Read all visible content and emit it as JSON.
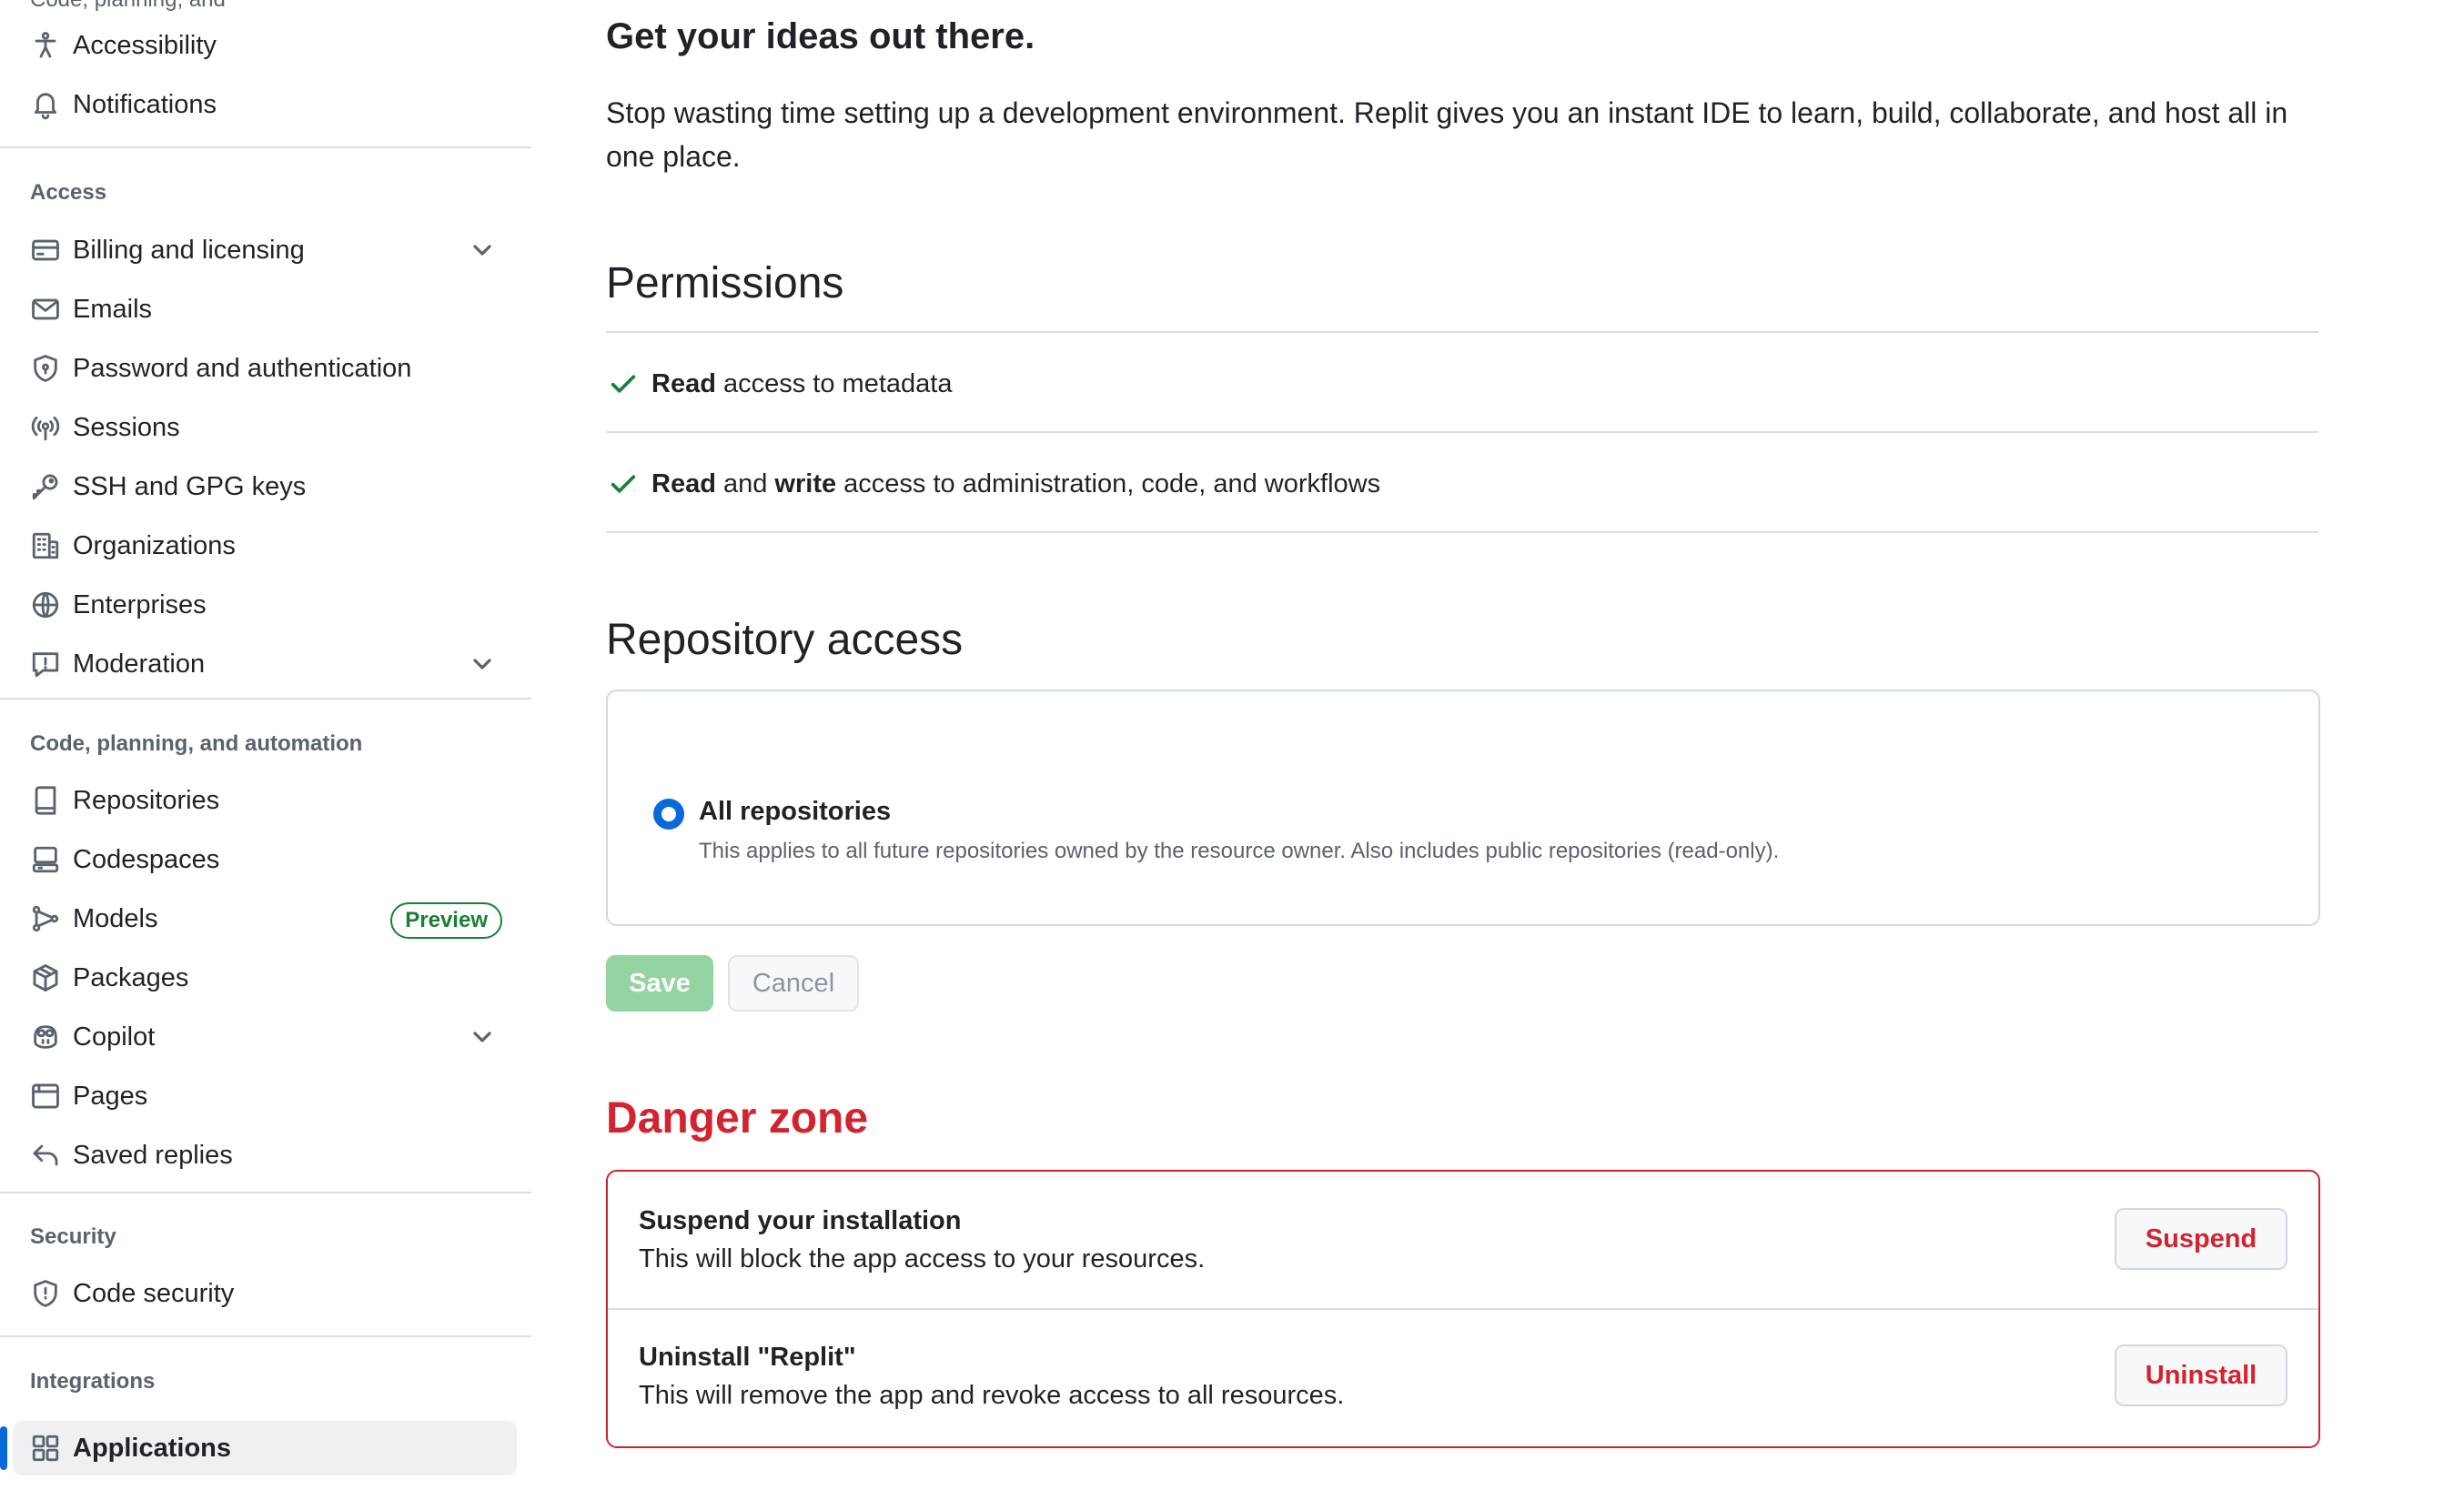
{
  "sidebar": {
    "partial_top_label": "Code, planning, and",
    "top_items": [
      {
        "label": "Accessibility",
        "icon": "accessibility-icon"
      },
      {
        "label": "Notifications",
        "icon": "bell-icon"
      }
    ],
    "sections": [
      {
        "title": "Access",
        "items": [
          {
            "label": "Billing and licensing",
            "icon": "credit-card-icon",
            "expandable": true
          },
          {
            "label": "Emails",
            "icon": "mail-icon"
          },
          {
            "label": "Password and authentication",
            "icon": "shield-lock-icon"
          },
          {
            "label": "Sessions",
            "icon": "broadcast-icon"
          },
          {
            "label": "SSH and GPG keys",
            "icon": "key-icon"
          },
          {
            "label": "Organizations",
            "icon": "organization-icon"
          },
          {
            "label": "Enterprises",
            "icon": "globe-icon"
          },
          {
            "label": "Moderation",
            "icon": "report-icon",
            "expandable": true
          }
        ]
      },
      {
        "title": "Code, planning, and automation",
        "items": [
          {
            "label": "Repositories",
            "icon": "repo-icon"
          },
          {
            "label": "Codespaces",
            "icon": "codespaces-icon"
          },
          {
            "label": "Models",
            "icon": "models-icon",
            "badge": "Preview"
          },
          {
            "label": "Packages",
            "icon": "package-icon"
          },
          {
            "label": "Copilot",
            "icon": "copilot-icon",
            "expandable": true
          },
          {
            "label": "Pages",
            "icon": "browser-icon"
          },
          {
            "label": "Saved replies",
            "icon": "reply-icon"
          }
        ]
      },
      {
        "title": "Security",
        "items": [
          {
            "label": "Code security",
            "icon": "shield-icon"
          }
        ]
      },
      {
        "title": "Integrations",
        "items": [
          {
            "label": "Applications",
            "icon": "apps-icon",
            "active": true
          }
        ]
      }
    ]
  },
  "main": {
    "intro_heading": "Get your ideas out there.",
    "intro_text": "Stop wasting time setting up a development environment. Replit gives you an instant IDE to learn, build, collaborate, and host all in one place.",
    "permissions": {
      "heading": "Permissions",
      "rows": [
        {
          "bold1": "Read",
          "mid": "",
          "bold2": "",
          "rest": " access to metadata"
        },
        {
          "bold1": "Read",
          "mid": " and ",
          "bold2": "write",
          "rest": " access to administration, code, and workflows"
        }
      ]
    },
    "repository_access": {
      "heading": "Repository access",
      "option_label": "All repositories",
      "option_desc": "This applies to all future repositories owned by the resource owner. Also includes public repositories (read-only).",
      "selected": true
    },
    "actions": {
      "save_label": "Save",
      "cancel_label": "Cancel"
    },
    "danger_zone": {
      "heading": "Danger zone",
      "rows": [
        {
          "title": "Suspend your installation",
          "desc": "This will block the app access to your resources.",
          "button": "Suspend"
        },
        {
          "title": "Uninstall \"Replit\"",
          "desc": "This will remove the app and revoke access to all resources.",
          "button": "Uninstall"
        }
      ]
    }
  },
  "colors": {
    "accent": "#0969da",
    "success": "#1a7f37",
    "danger": "#d1242f",
    "save_disabled": "#94d3a2"
  }
}
